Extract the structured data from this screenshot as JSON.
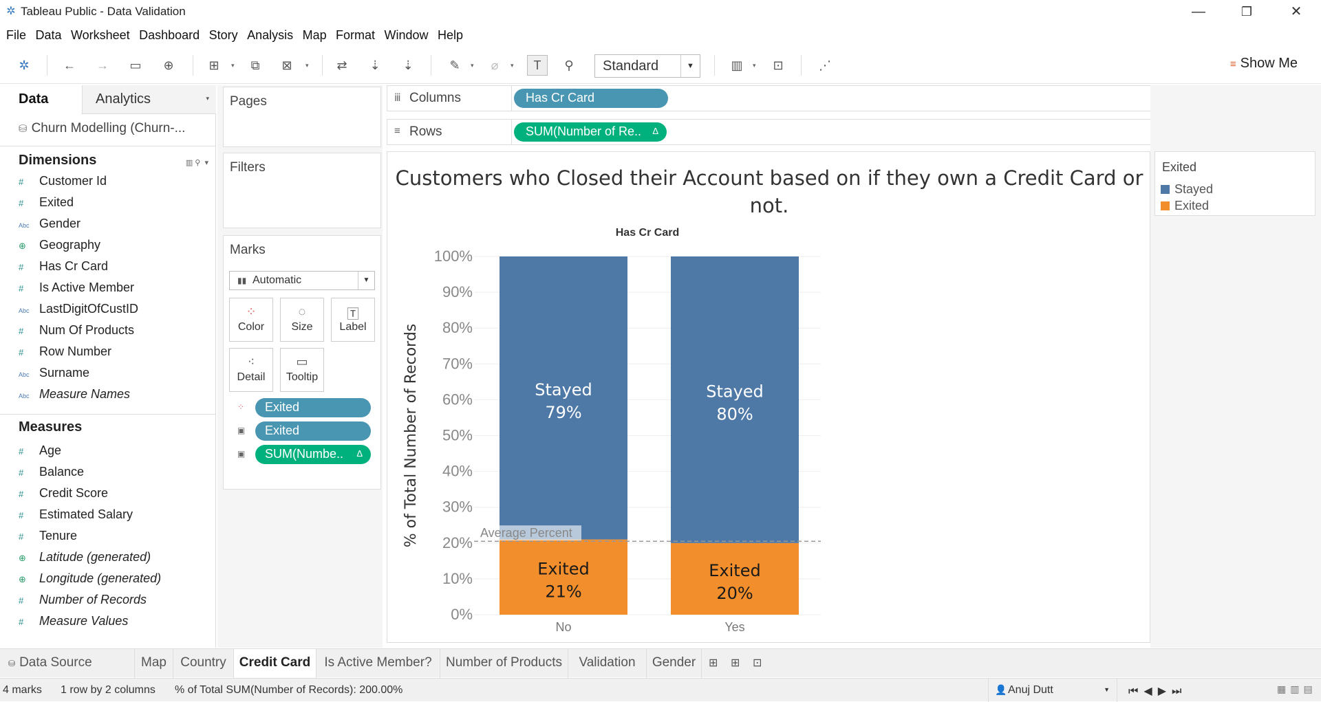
{
  "window": {
    "title": "Tableau Public - Data Validation",
    "min": "—",
    "restore": "❐",
    "close": "✕"
  },
  "menu": [
    "File",
    "Data",
    "Worksheet",
    "Dashboard",
    "Story",
    "Analysis",
    "Map",
    "Format",
    "Window",
    "Help"
  ],
  "toolbar": {
    "fit_select": "Standard",
    "show_me": "Show Me"
  },
  "left": {
    "tab_data": "Data",
    "tab_analytics": "Analytics",
    "datasource": "Churn Modelling (Churn-...",
    "dimensions_header": "Dimensions",
    "dimensions": [
      {
        "label": "Customer Id",
        "icon": "#",
        "italic": false
      },
      {
        "label": "Exited",
        "icon": "#",
        "italic": false
      },
      {
        "label": "Gender",
        "icon": "Abc",
        "italic": false
      },
      {
        "label": "Geography",
        "icon": "geo",
        "italic": false
      },
      {
        "label": "Has Cr Card",
        "icon": "#",
        "italic": false
      },
      {
        "label": "Is Active Member",
        "icon": "#",
        "italic": false
      },
      {
        "label": "LastDigitOfCustID",
        "icon": "Abc",
        "italic": false
      },
      {
        "label": "Num Of Products",
        "icon": "#",
        "italic": false
      },
      {
        "label": "Row Number",
        "icon": "#",
        "italic": false
      },
      {
        "label": "Surname",
        "icon": "Abc",
        "italic": false
      },
      {
        "label": "Measure Names",
        "icon": "Abc",
        "italic": true
      }
    ],
    "measures_header": "Measures",
    "measures": [
      {
        "label": "Age",
        "icon": "#",
        "italic": false
      },
      {
        "label": "Balance",
        "icon": "#",
        "italic": false
      },
      {
        "label": "Credit Score",
        "icon": "#",
        "italic": false
      },
      {
        "label": "Estimated Salary",
        "icon": "#",
        "italic": false
      },
      {
        "label": "Tenure",
        "icon": "#",
        "italic": false
      },
      {
        "label": "Latitude (generated)",
        "icon": "geo",
        "italic": true
      },
      {
        "label": "Longitude (generated)",
        "icon": "geo",
        "italic": true
      },
      {
        "label": "Number of Records",
        "icon": "#",
        "italic": true
      },
      {
        "label": "Measure Values",
        "icon": "#",
        "italic": true
      }
    ]
  },
  "cards": {
    "pages": "Pages",
    "filters": "Filters",
    "marks": "Marks",
    "mark_type": "Automatic",
    "buttons": {
      "color": "Color",
      "size": "Size",
      "label": "Label",
      "detail": "Detail",
      "tooltip": "Tooltip"
    },
    "pills": [
      "Exited",
      "Exited",
      "SUM(Numbe.."
    ]
  },
  "shelves": {
    "columns_label": "Columns",
    "columns_pill": "Has Cr Card",
    "rows_label": "Rows",
    "rows_pill": "SUM(Number of Re.."
  },
  "colors": {
    "stayed": "#4e79a7",
    "exited": "#f28e2b",
    "blue_pill": "#4996b2",
    "green_pill": "#00b17d"
  },
  "chart_data": {
    "type": "bar",
    "stacked": true,
    "title": "Customers who Closed their Account based on if they own a Credit Card or not.",
    "header": "Has Cr Card",
    "categories": [
      "No",
      "Yes"
    ],
    "series": [
      {
        "name": "Exited",
        "values": [
          21,
          20
        ],
        "labels": [
          "21%",
          "20%"
        ]
      },
      {
        "name": "Stayed",
        "values": [
          79,
          80
        ],
        "labels": [
          "79%",
          "80%"
        ]
      }
    ],
    "ylabel": "% of Total Number of Records",
    "ylim": [
      0,
      100
    ],
    "yticks": [
      "0%",
      "10%",
      "20%",
      "30%",
      "40%",
      "50%",
      "60%",
      "70%",
      "80%",
      "90%",
      "100%"
    ],
    "reference_line": {
      "label": "Average Percent",
      "value": 20.5
    },
    "legend": {
      "title": "Exited",
      "items": [
        "Stayed",
        "Exited"
      ],
      "position": "right"
    }
  },
  "sheets": {
    "data_source": "Data Source",
    "tabs": [
      "Map",
      "Country",
      "Credit Card",
      "Is Active Member?",
      "Number of Products",
      "Validation",
      "Gender"
    ],
    "active": "Credit Card"
  },
  "status": {
    "marks": "4 marks",
    "shape": "1 row by 2 columns",
    "sum": "% of Total SUM(Number of Records): 200.00%",
    "user": "Anuj Dutt"
  }
}
